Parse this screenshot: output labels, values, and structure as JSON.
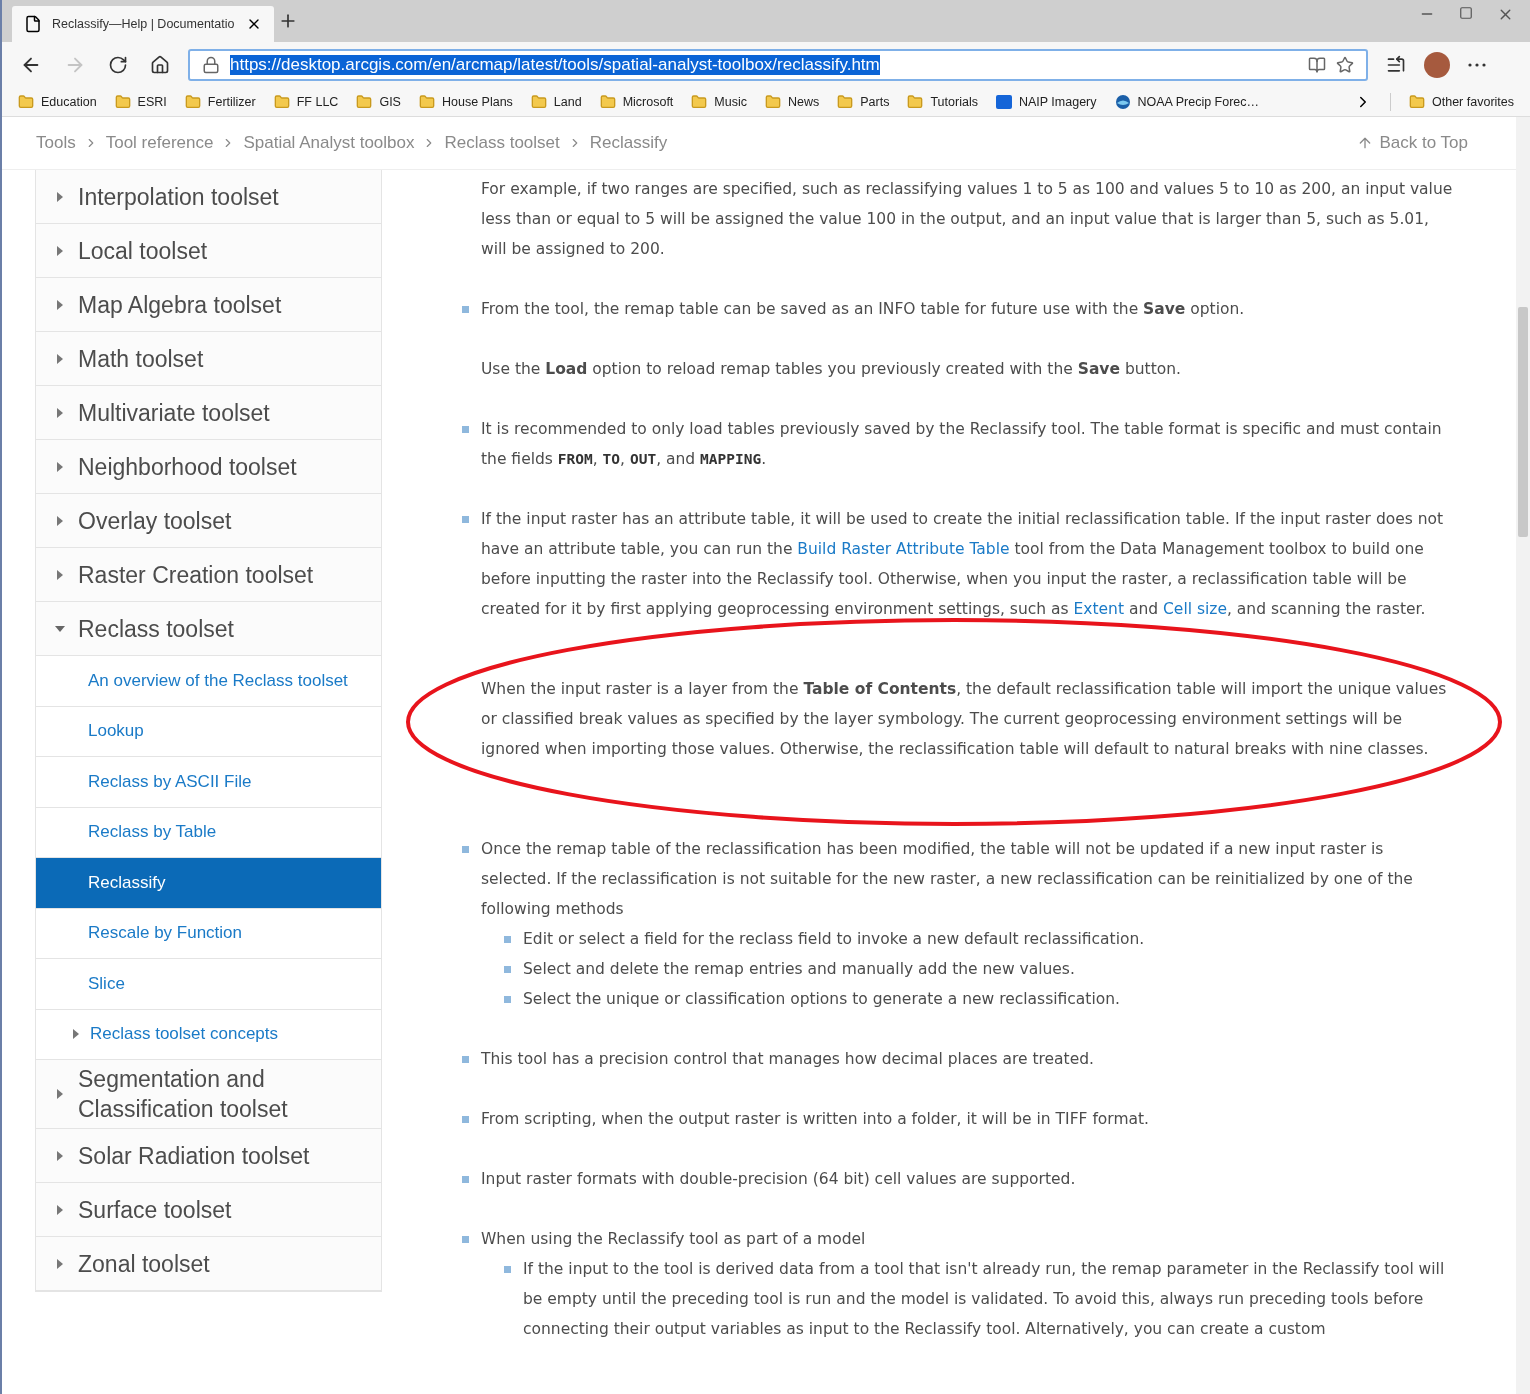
{
  "browser": {
    "tab": {
      "title": "Reclassify—Help | Documentatio"
    },
    "nav": {
      "forward_disabled": true
    },
    "address": {
      "value": "https://desktop.arcgis.com/en/arcmap/latest/tools/spatial-analyst-toolbox/reclassify.htm",
      "selected": true
    },
    "bookmarks": [
      {
        "label": "Education",
        "kind": "folder"
      },
      {
        "label": "ESRI",
        "kind": "folder"
      },
      {
        "label": "Fertilizer",
        "kind": "folder"
      },
      {
        "label": "FF LLC",
        "kind": "folder"
      },
      {
        "label": "GIS",
        "kind": "folder"
      },
      {
        "label": "House Plans",
        "kind": "folder"
      },
      {
        "label": "Land",
        "kind": "folder"
      },
      {
        "label": "Microsoft",
        "kind": "folder"
      },
      {
        "label": "Music",
        "kind": "folder"
      },
      {
        "label": "News",
        "kind": "folder"
      },
      {
        "label": "Parts",
        "kind": "folder"
      },
      {
        "label": "Tutorials",
        "kind": "folder"
      },
      {
        "label": "NAIP Imagery",
        "kind": "box"
      },
      {
        "label": "NOAA Precip Forec…",
        "kind": "globe"
      }
    ],
    "other_favorites": "Other favorites"
  },
  "breadcrumb": [
    "Tools",
    "Tool reference",
    "Spatial Analyst toolbox",
    "Reclass toolset",
    "Reclassify"
  ],
  "back_to_top": "Back to Top",
  "sidebar": {
    "items": [
      {
        "label": "Interpolation toolset",
        "expanded": false,
        "selected": false
      },
      {
        "label": "Local toolset",
        "expanded": false,
        "selected": false
      },
      {
        "label": "Map Algebra toolset",
        "expanded": false,
        "selected": false
      },
      {
        "label": "Math toolset",
        "expanded": false,
        "selected": false
      },
      {
        "label": "Multivariate toolset",
        "expanded": false,
        "selected": false
      },
      {
        "label": "Neighborhood toolset",
        "expanded": false,
        "selected": false
      },
      {
        "label": "Overlay toolset",
        "expanded": false,
        "selected": false
      },
      {
        "label": "Raster Creation toolset",
        "expanded": false,
        "selected": false
      },
      {
        "label": "Reclass toolset",
        "expanded": true,
        "selected": false,
        "children": [
          {
            "label": "An overview of the Reclass toolset",
            "selected": false
          },
          {
            "label": "Lookup",
            "selected": false
          },
          {
            "label": "Reclass by ASCII File",
            "selected": false
          },
          {
            "label": "Reclass by Table",
            "selected": false
          },
          {
            "label": "Reclassify",
            "selected": true
          },
          {
            "label": "Rescale by Function",
            "selected": false
          },
          {
            "label": "Slice",
            "selected": false
          },
          {
            "label": "Reclass toolset concepts",
            "selected": false,
            "expanded": false
          }
        ]
      },
      {
        "label": "Segmentation and Classification toolset",
        "expanded": false,
        "selected": false
      },
      {
        "label": "Solar Radiation toolset",
        "expanded": false,
        "selected": false
      },
      {
        "label": "Surface toolset",
        "expanded": false,
        "selected": false
      },
      {
        "label": "Zonal toolset",
        "expanded": false,
        "selected": false
      }
    ]
  },
  "content": {
    "paragraphs": [
      {
        "kind": "plain",
        "segments": [
          {
            "kind": "text",
            "text": "For example, if two ranges are specified, such as reclassifying values 1 to 5 as 100 and values 5 to 10 as 200, an input value less than or equal to 5 will be assigned the value 100 in the output, and an input value that is larger than 5, such as 5.01, will be assigned to 200."
          }
        ]
      },
      {
        "kind": "bullet",
        "segments": [
          {
            "kind": "text",
            "text": "From the tool, the remap table can be saved as an INFO table for future use with the **Save** option."
          }
        ]
      },
      {
        "kind": "plain",
        "segments": [
          {
            "kind": "text",
            "text": "Use the **Load** option to reload remap tables you previously created with the **Save** button."
          }
        ]
      },
      {
        "kind": "bullet",
        "segments": [
          {
            "kind": "text",
            "text": "It is recommended to only load tables previously saved by the Reclassify tool. The table format is specific and must contain the fields "
          },
          {
            "kind": "code",
            "text": "FROM"
          },
          {
            "kind": "text",
            "text": ", "
          },
          {
            "kind": "code",
            "text": "TO"
          },
          {
            "kind": "text",
            "text": ", "
          },
          {
            "kind": "code",
            "text": "OUT"
          },
          {
            "kind": "text",
            "text": ", and "
          },
          {
            "kind": "code",
            "text": "MAPPING"
          },
          {
            "kind": "text",
            "text": "."
          }
        ]
      },
      {
        "kind": "bullet",
        "segments": [
          {
            "kind": "text",
            "text": "If the input raster has an attribute table, it will be used to create the initial reclassification table. If the input raster does not have an attribute table, you can run the "
          },
          {
            "kind": "link",
            "text": "Build Raster Attribute Table"
          },
          {
            "kind": "text",
            "text": " tool from the Data Management toolbox to build one before inputting the raster into the Reclassify tool. Otherwise, when you input the raster, a reclassification table will be created for it by first applying geoprocessing environment settings, such as "
          },
          {
            "kind": "link",
            "text": "Extent"
          },
          {
            "kind": "text",
            "text": " and "
          },
          {
            "kind": "link",
            "text": "Cell size"
          },
          {
            "kind": "text",
            "text": ", and scanning the raster."
          }
        ]
      },
      {
        "kind": "plain",
        "circled": true,
        "segments": [
          {
            "kind": "text",
            "text": "When the input raster is a layer from the **Table of Contents**, the default reclassification table will import the unique values or classified break values as specified by the layer symbology. The current geoprocessing environment settings will be ignored when importing those values. Otherwise, the reclassification table will default to natural breaks with nine classes."
          }
        ]
      },
      {
        "kind": "bullet",
        "segments": [
          {
            "kind": "text",
            "text": "Once the remap table of the reclassification has been modified, the table will not be updated if a new input raster is selected. If the reclassification is not suitable for the new raster, a new reclassification can be reinitialized by one of the following methods"
          }
        ],
        "children": [
          {
            "segments": [
              {
                "kind": "text",
                "text": "Edit or select a field for the reclass field to invoke a new default reclassification."
              }
            ]
          },
          {
            "segments": [
              {
                "kind": "text",
                "text": "Select and delete the remap entries and manually add the new values."
              }
            ]
          },
          {
            "segments": [
              {
                "kind": "text",
                "text": "Select the unique or classification options to generate a new reclassification."
              }
            ]
          }
        ]
      },
      {
        "kind": "bullet",
        "segments": [
          {
            "kind": "text",
            "text": "This tool has a precision control that manages how decimal places are treated."
          }
        ]
      },
      {
        "kind": "bullet",
        "segments": [
          {
            "kind": "text",
            "text": "From scripting, when the output raster is written into a folder, it will be in TIFF format."
          }
        ]
      },
      {
        "kind": "bullet",
        "segments": [
          {
            "kind": "text",
            "text": "Input raster formats with double-precision (64 bit) cell values are supported."
          }
        ]
      },
      {
        "kind": "bullet",
        "segments": [
          {
            "kind": "text",
            "text": "When using the Reclassify tool as part of a model"
          }
        ],
        "children": [
          {
            "segments": [
              {
                "kind": "text",
                "text": "If the input to the tool is derived data from a tool that isn't already run, the remap parameter in the Reclassify tool will be empty until the preceding tool is run and the model is validated. To avoid this, always run preceding tools before connecting their output variables as input to the Reclassify tool. Alternatively, you can create a custom"
              }
            ]
          }
        ]
      }
    ]
  }
}
